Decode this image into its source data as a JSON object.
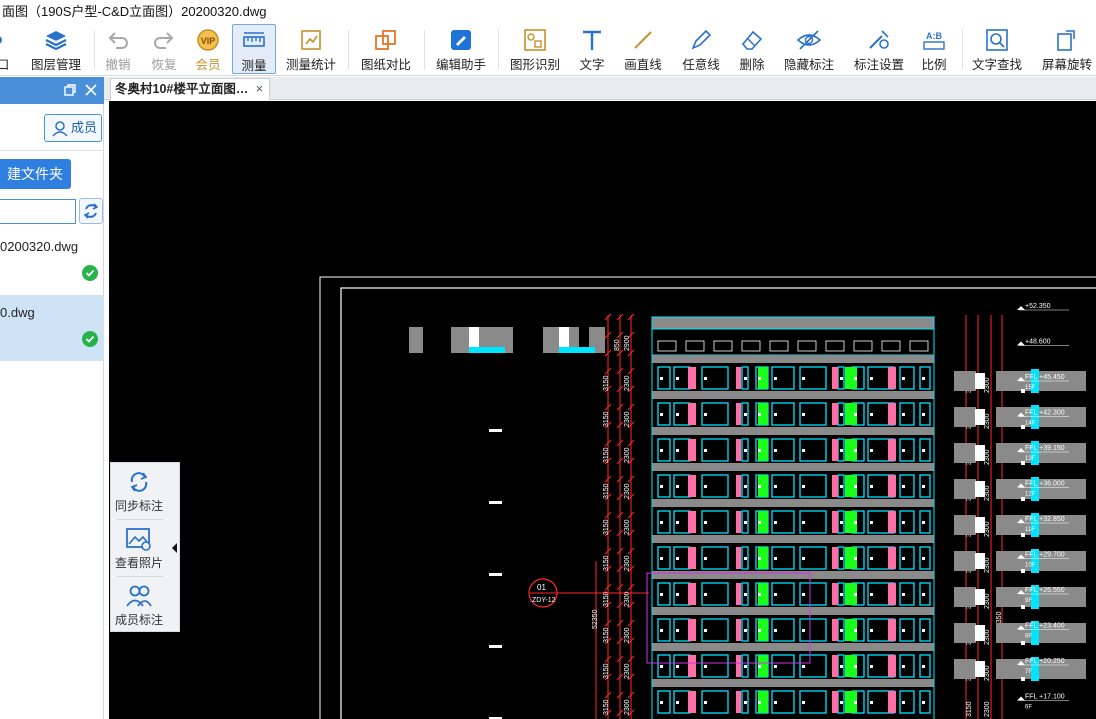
{
  "window": {
    "title": "面图（190S户型-C&D立面图）20200320.dwg"
  },
  "toolbar": {
    "window_label": "口",
    "layers_label": "图层管理",
    "undo_label": "撤销",
    "redo_label": "恢复",
    "vip_label": "会员",
    "vip_badge": "VIP",
    "measure_label": "测量",
    "measure_stats_label": "测量统计",
    "compare_label": "图纸对比",
    "edit_helper_label": "编辑助手",
    "shape_recognize_label": "图形识别",
    "text_label": "文字",
    "line_label": "画直线",
    "freeline_label": "任意线",
    "delete_label": "删除",
    "hide_label": "隐藏标注",
    "dim_settings_label": "标注设置",
    "scale_label": "比例",
    "text_search_label": "文字查找",
    "rotate_label": "屏幕旋转",
    "scale_icon_text": "A:B"
  },
  "left_panel": {
    "member_label": "成员",
    "new_folder_label": "建文件夹",
    "search_value": "",
    "files": [
      {
        "name": "0200320.dwg",
        "status": "synced"
      },
      {
        "name": "0.dwg",
        "status": "synced"
      }
    ]
  },
  "tabs": [
    {
      "label": "冬奥村10#楼平立面图…",
      "close": "×"
    }
  ],
  "float_toolbar": {
    "sync_label": "同步标注",
    "photos_label": "查看照片",
    "member_dim_label": "成员标注"
  },
  "drawing": {
    "callout_top": "01",
    "callout_bottom": "ZDY-12",
    "total_dim": "52350",
    "right_dim": "52350",
    "level_labels": [
      "+52.350",
      "+48.600",
      "FFL +45.450",
      "FFL +42.300",
      "FFL +39.150",
      "FFL +36.000",
      "FFL +32.850",
      "FFL +29.700",
      "FFL +26.550",
      "FFL +23.400",
      "FFL +20.250",
      "FFL +17.100"
    ],
    "floor_labels": [
      "15F",
      "14F",
      "13F",
      "12F",
      "11F",
      "10F",
      "9F",
      "8F",
      "7F",
      "6F"
    ],
    "dims_left": [
      "2900",
      "850",
      "3150",
      "2300",
      "850"
    ],
    "colors": {
      "bg": "#000000",
      "red": "#ff2a2a",
      "cyan": "#00e5ff",
      "pink": "#ff6fa5",
      "green": "#19ff19",
      "gray": "#8a8a8a",
      "white": "#ffffff"
    }
  }
}
